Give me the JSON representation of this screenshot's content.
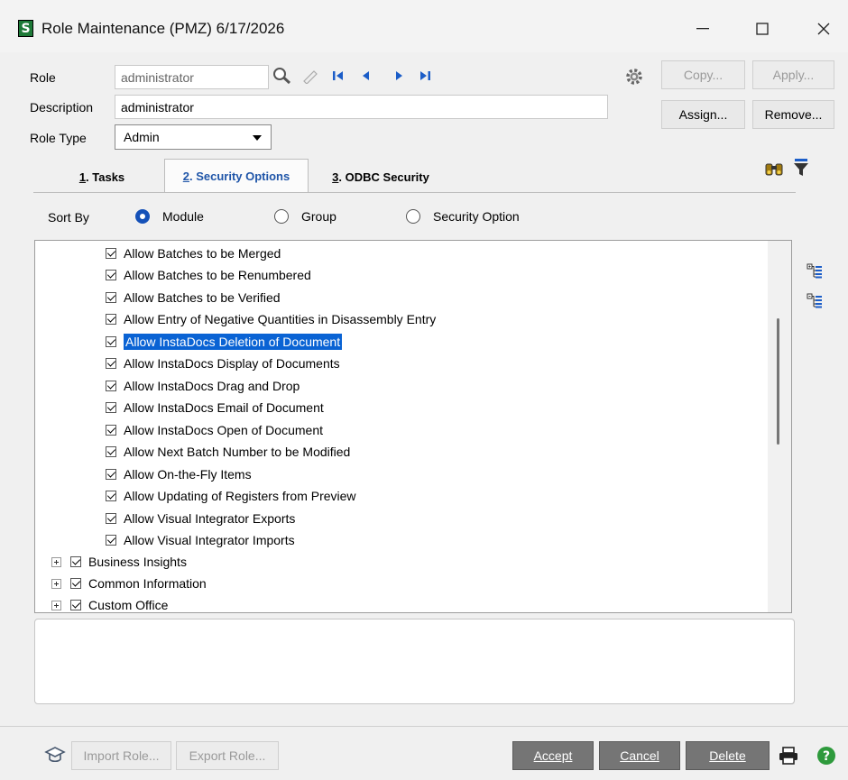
{
  "window": {
    "title": "Role Maintenance (PMZ) 6/17/2026",
    "app_glyph": "S",
    "minimize_icon": "minimize-icon",
    "maximize_icon": "maximize-icon",
    "close_icon": "close-icon"
  },
  "form": {
    "role_label": "Role",
    "role_value": "administrator",
    "description_label": "Description",
    "description_value": "administrator",
    "role_type_label": "Role Type",
    "role_type_value": "Admin"
  },
  "buttons": {
    "copy": "Copy...",
    "apply": "Apply...",
    "assign": "Assign...",
    "remove": "Remove...",
    "import_role": "Import Role...",
    "export_role": "Export Role...",
    "accept": "Accept",
    "cancel": "Cancel",
    "delete": "Delete"
  },
  "tabs": [
    {
      "num": "1",
      "label": ". Tasks"
    },
    {
      "num": "2",
      "label": ". Security Options"
    },
    {
      "num": "3",
      "label": ". ODBC Security"
    }
  ],
  "sort": {
    "label": "Sort By",
    "options": [
      "Module",
      "Group",
      "Security Option"
    ],
    "selected": "Module"
  },
  "tree": {
    "items": [
      "Allow Batches to be Merged",
      "Allow Batches to be Renumbered",
      "Allow Batches to be Verified",
      "Allow Entry of Negative Quantities in Disassembly Entry",
      "Allow InstaDocs Deletion of Document",
      "Allow InstaDocs Display of Documents",
      "Allow InstaDocs Drag and Drop",
      "Allow InstaDocs Email of Document",
      "Allow InstaDocs Open of Document",
      "Allow Next Batch Number to be Modified",
      "Allow On-the-Fly Items",
      "Allow Updating of Registers from Preview",
      "Allow Visual Integrator Exports",
      "Allow Visual Integrator Imports"
    ],
    "selected_index": 4,
    "groups": [
      "Business Insights",
      "Common Information",
      "Custom Office"
    ]
  },
  "colors": {
    "accent": "#1551b8",
    "selection": "#0a63d4",
    "dark_button": "#757575"
  }
}
